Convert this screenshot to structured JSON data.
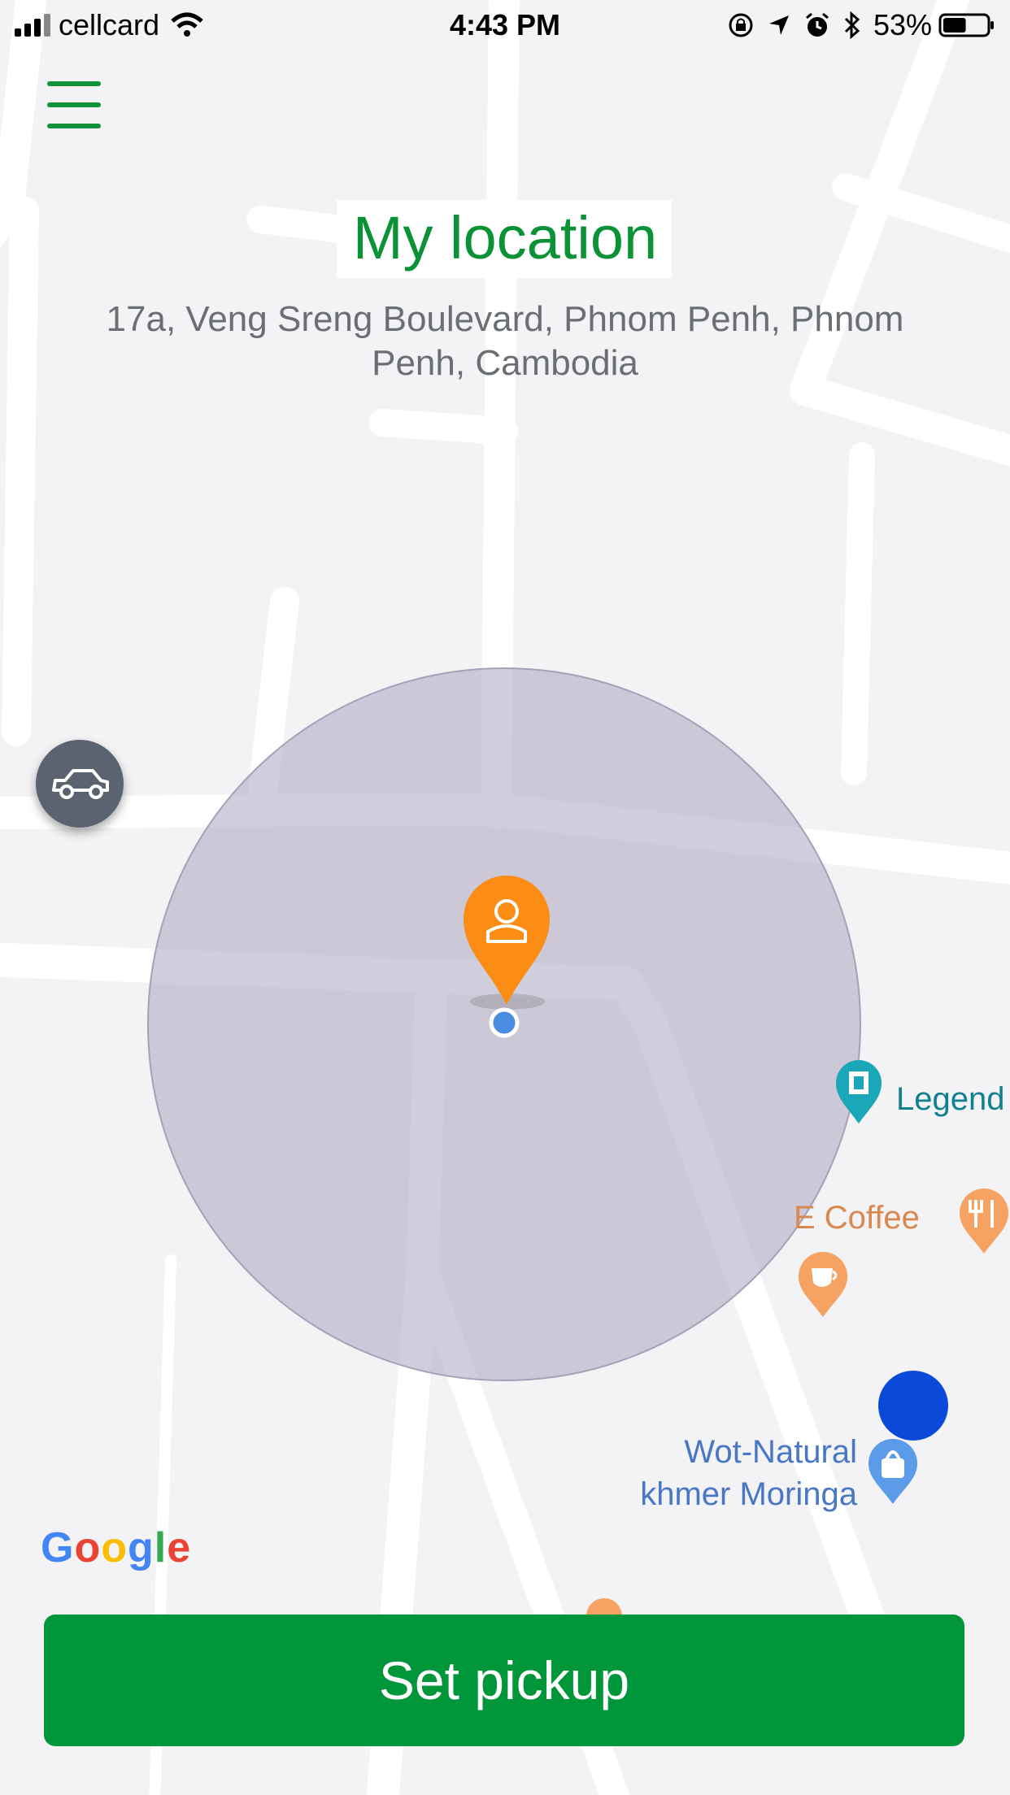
{
  "status_bar": {
    "carrier": "cellcard",
    "time": "4:43 PM",
    "battery": "53%",
    "battery_level": 0.53
  },
  "header": {
    "title": "My location",
    "address": "17a, Veng Sreng Boulevard, Phnom Penh, Phnom Penh, Cambodia"
  },
  "map": {
    "pois": {
      "legend": "Legend",
      "ecoffee": "E Coffee",
      "wot_line1": "Wot-Natural",
      "wot_line2": "khmer Moringa"
    },
    "attribution": {
      "G": "G",
      "o1": "o",
      "o2": "o",
      "g": "g",
      "l": "l",
      "e": "e"
    }
  },
  "actions": {
    "set_pickup": "Set pickup"
  },
  "colors": {
    "brand_green": "#009639",
    "pin_orange": "#fb8c14",
    "accuracy_circle": "#c9c5d6",
    "location_dot": "#4a90e2",
    "icons": [
      "menu-icon",
      "car-icon",
      "person-pin-icon",
      "cinema-icon",
      "coffee-icon",
      "restaurant-icon",
      "shopping-icon",
      "wifi-icon",
      "location-arrow-icon",
      "alarm-icon",
      "bluetooth-icon",
      "battery-icon"
    ]
  }
}
